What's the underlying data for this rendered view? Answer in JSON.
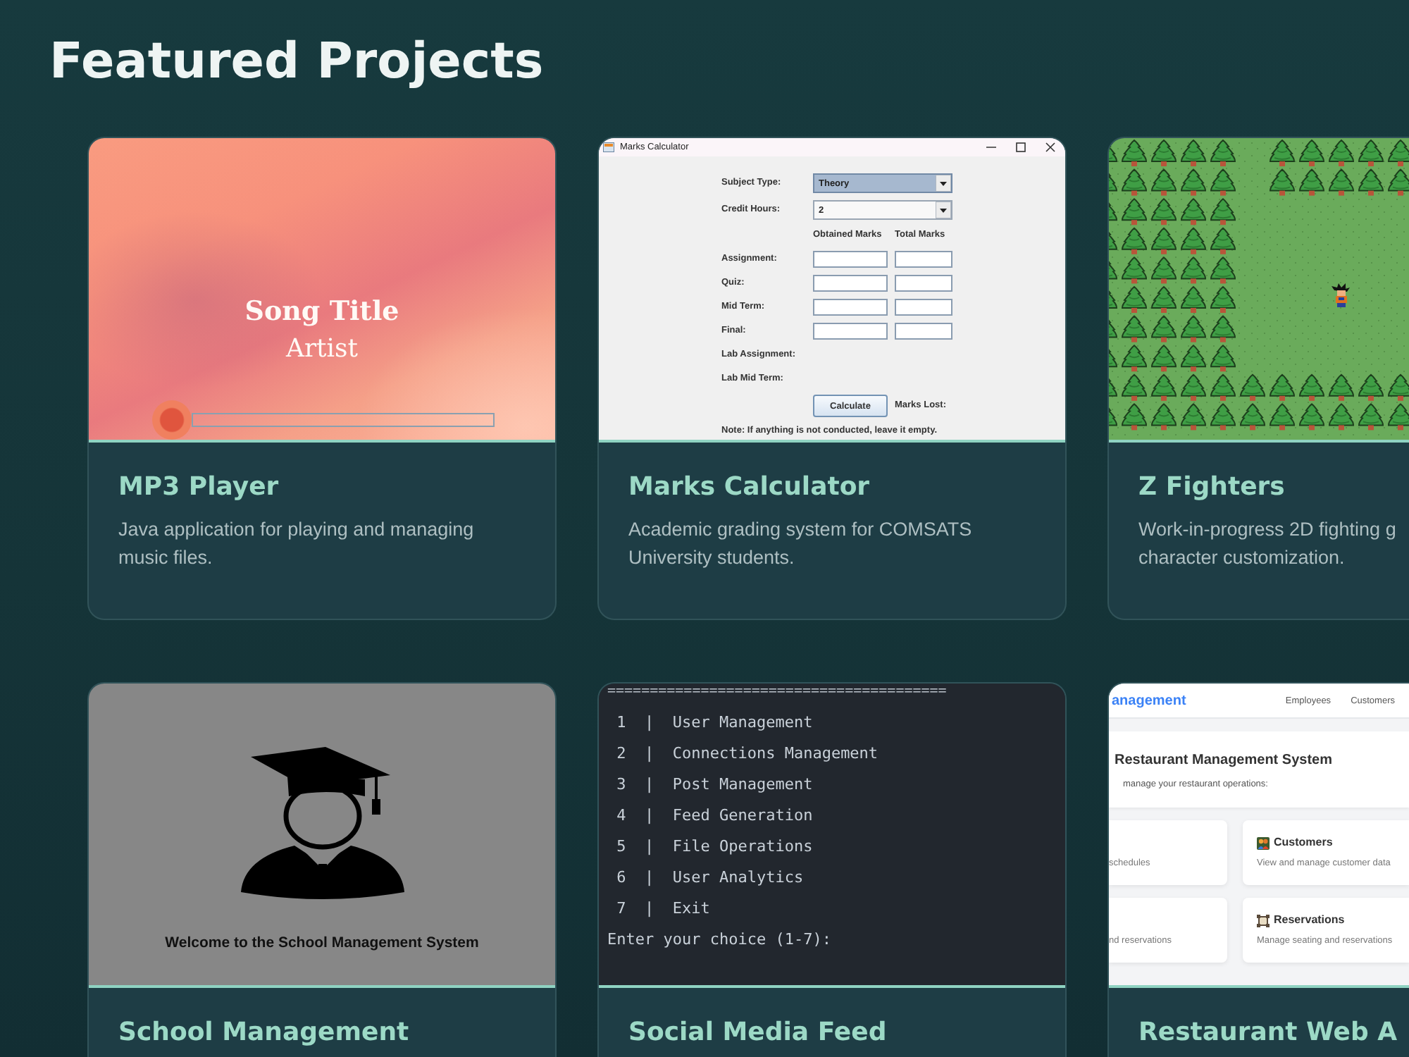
{
  "page": {
    "title": "Featured Projects"
  },
  "projects": [
    {
      "kind": "player",
      "title": "MP3 Player",
      "description": "Java application for playing and managing\nmusic files.",
      "preview": {
        "song_title": "Song Title",
        "artist": "Artist",
        "progress": {
          "level": 0
        }
      }
    },
    {
      "kind": "form",
      "title": "Marks Calculator",
      "description": "Academic grading system for COMSATS\nUniversity students.",
      "preview": {
        "window_title": "Marks Calculator",
        "dropdowns": [
          {
            "label": "Subject Type:",
            "value": "Theory",
            "focused": true
          },
          {
            "label": "Credit Hours:",
            "value": "2",
            "focused": false
          }
        ],
        "columns": [
          "Obtained Marks",
          "Total Marks"
        ],
        "rows": [
          {
            "kind": "inputs",
            "label": "Assignment:"
          },
          {
            "kind": "inputs",
            "label": "Quiz:"
          },
          {
            "kind": "inputs",
            "label": "Mid Term:"
          },
          {
            "kind": "inputs",
            "label": "Final:"
          },
          {
            "kind": "text",
            "label": "Lab Assignment:"
          },
          {
            "kind": "text",
            "label": "Lab Mid Term:"
          }
        ],
        "button": "Calculate",
        "result_label": "Marks Lost:",
        "note": "Note: If anything is not conducted, leave it empty."
      }
    },
    {
      "kind": "game",
      "title": "Z Fighters",
      "description": "Work-in-progress 2D fighting g\ncharacter customization."
    },
    {
      "kind": "splash",
      "title": "School Management",
      "preview": {
        "caption": "Welcome to the School Management System"
      }
    },
    {
      "kind": "terminal",
      "title": "Social Media Feed",
      "preview": {
        "lines": [
          "========================================",
          " 1  |  User Management",
          " 2  |  Connections Management",
          " 3  |  Post Management",
          " 4  |  Feed Generation",
          " 5  |  File Operations",
          " 6  |  User Analytics",
          " 7  |  Exit",
          "Enter your choice (1-7):"
        ]
      }
    },
    {
      "kind": "webapp",
      "title": "Restaurant Web A",
      "preview": {
        "brand": "anagement",
        "nav": [
          "Employees",
          "Customers"
        ],
        "heading": "Restaurant Management System",
        "subtitle": "manage your restaurant operations:",
        "tiles": [
          {
            "kind": "partial",
            "text": "schedules"
          },
          {
            "kind": "people",
            "title": "Customers",
            "text": "View and manage customer data"
          },
          {
            "kind": "partial",
            "text": "nd reservations"
          },
          {
            "kind": "frame",
            "title": "Reservations",
            "text": "Manage seating and reservations"
          }
        ]
      }
    }
  ]
}
